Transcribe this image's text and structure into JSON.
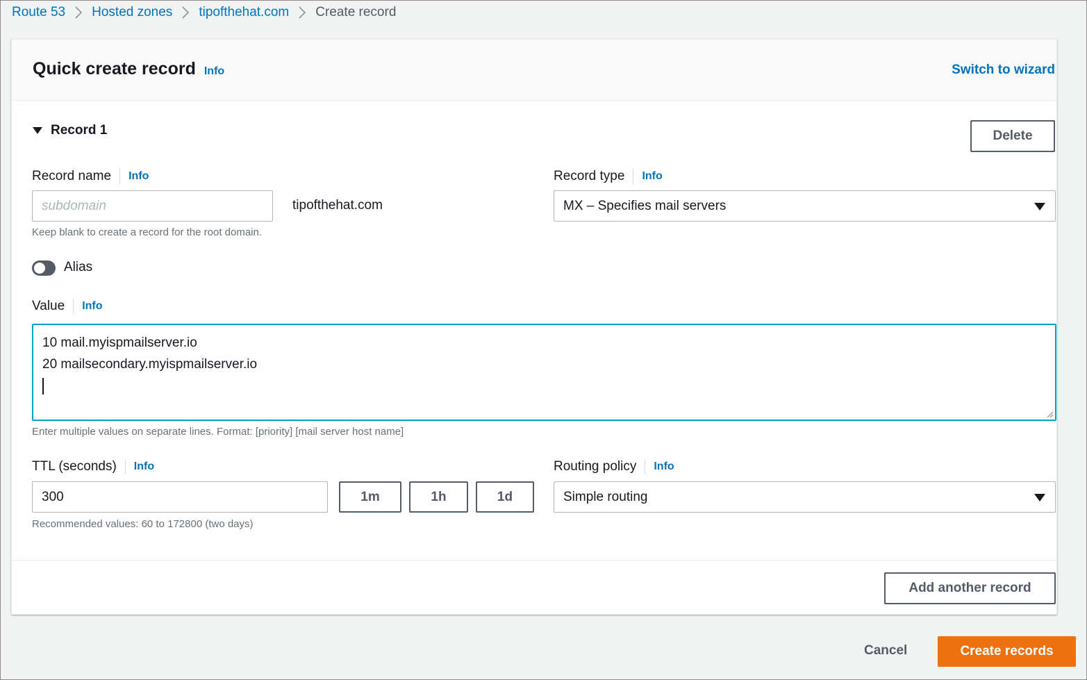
{
  "breadcrumb": {
    "items": [
      "Route 53",
      "Hosted zones",
      "tipofthehat.com"
    ],
    "current": "Create record"
  },
  "panel": {
    "title": "Quick create record",
    "title_info": "Info",
    "switch_link": "Switch to wizard"
  },
  "record": {
    "heading": "Record 1",
    "delete_label": "Delete",
    "record_name": {
      "label": "Record name",
      "info": "Info",
      "placeholder": "subdomain",
      "value": "",
      "domain_suffix": "tipofthehat.com",
      "hint": "Keep blank to create a record for the root domain."
    },
    "record_type": {
      "label": "Record type",
      "info": "Info",
      "selected": "MX – Specifies mail servers"
    },
    "alias": {
      "label": "Alias",
      "enabled": false
    },
    "value": {
      "label": "Value",
      "info": "Info",
      "lines": [
        "10 mail.myispmailserver.io",
        "20 mailsecondary.myispmailserver.io"
      ],
      "hint": "Enter multiple values on separate lines. Format: [priority] [mail server host name]"
    },
    "ttl": {
      "label": "TTL (seconds)",
      "info": "Info",
      "value": "300",
      "presets": [
        "1m",
        "1h",
        "1d"
      ],
      "hint": "Recommended values: 60 to 172800 (two days)"
    },
    "routing_policy": {
      "label": "Routing policy",
      "info": "Info",
      "selected": "Simple routing"
    }
  },
  "add_another_label": "Add another record",
  "actions": {
    "cancel_label": "Cancel",
    "create_label": "Create records"
  },
  "colors": {
    "link": "#0073bb",
    "primary": "#ec7211",
    "focus": "#00a1c9"
  }
}
